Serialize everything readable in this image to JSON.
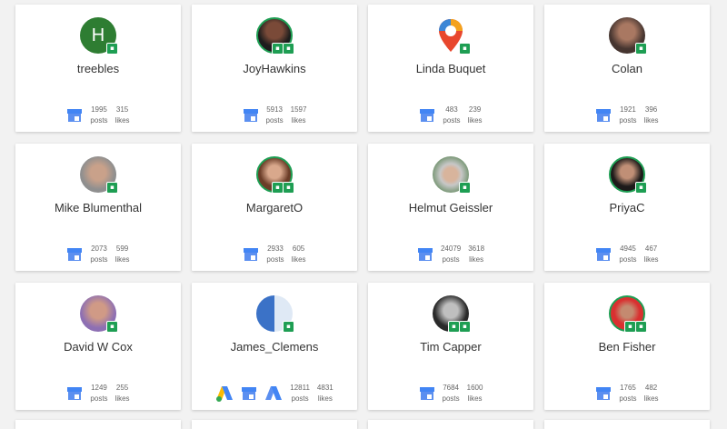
{
  "cards": [
    {
      "name": "treebles",
      "posts": "1995",
      "likes": "315",
      "posts_label": "posts",
      "likes_label": "likes",
      "avatar": "letter-H",
      "letter": "H"
    },
    {
      "name": "JoyHawkins",
      "posts": "5913",
      "likes": "1597",
      "posts_label": "posts",
      "likes_label": "likes",
      "avatar": "photo"
    },
    {
      "name": "Linda Buquet",
      "posts": "483",
      "likes": "239",
      "posts_label": "posts",
      "likes_label": "likes",
      "avatar": "map-pin"
    },
    {
      "name": "Colan",
      "posts": "1921",
      "likes": "396",
      "posts_label": "posts",
      "likes_label": "likes",
      "avatar": "photo"
    },
    {
      "name": "Mike Blumenthal",
      "posts": "2073",
      "likes": "599",
      "posts_label": "posts",
      "likes_label": "likes",
      "avatar": "photo"
    },
    {
      "name": "MargaretO",
      "posts": "2933",
      "likes": "605",
      "posts_label": "posts",
      "likes_label": "likes",
      "avatar": "photo"
    },
    {
      "name": "Helmut Geissler",
      "posts": "24079",
      "likes": "3618",
      "posts_label": "posts",
      "likes_label": "likes",
      "avatar": "photo"
    },
    {
      "name": "PriyaC",
      "posts": "4945",
      "likes": "467",
      "posts_label": "posts",
      "likes_label": "likes",
      "avatar": "photo"
    },
    {
      "name": "David W Cox",
      "posts": "1249",
      "likes": "255",
      "posts_label": "posts",
      "likes_label": "likes",
      "avatar": "photo"
    },
    {
      "name": "James_Clemens",
      "posts": "12811",
      "likes": "4831",
      "posts_label": "posts",
      "likes_label": "likes",
      "avatar": "photo"
    },
    {
      "name": "Tim Capper",
      "posts": "7684",
      "likes": "1600",
      "posts_label": "posts",
      "likes_label": "likes",
      "avatar": "photo"
    },
    {
      "name": "Ben Fisher",
      "posts": "1765",
      "likes": "482",
      "posts_label": "posts",
      "likes_label": "likes",
      "avatar": "photo"
    }
  ],
  "colors": {
    "accent_green": "#1e9e53",
    "store_blue": "#4285f4",
    "ads_yellow": "#fbbc04",
    "ads_green": "#34a853"
  }
}
